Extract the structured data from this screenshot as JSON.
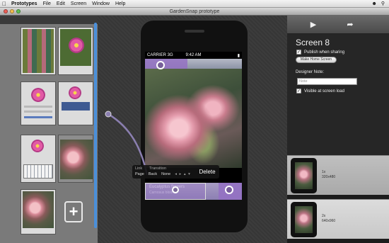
{
  "menubar": {
    "app_name": "Prototypes",
    "items": [
      "File",
      "Edit",
      "Screen",
      "Window",
      "Help"
    ],
    "right_icons": [
      "user-icon",
      "search-icon"
    ]
  },
  "window": {
    "title": "GardenSnap prototype"
  },
  "phone": {
    "carrier": "CARRIER 3G",
    "time": "9:42 AM",
    "bottom_title": "Eucalyptus flowers",
    "bottom_subtitle": "Carnosus blooms"
  },
  "link_popover": {
    "link_label": "Link",
    "transition_label": "Transition",
    "target_value": "Page",
    "back_label": "Back",
    "transition_value": "None",
    "delete_label": "Delete"
  },
  "inspector": {
    "screen_name": "Screen 8",
    "publish_label": "Publish when sharing",
    "publish_checked": true,
    "make_home_label": "Make Home Screen",
    "designer_note_label": "Designer Note:",
    "note_placeholder": "Note",
    "visible_label": "Visible at screen load",
    "visible_checked": true
  },
  "devices": [
    {
      "scale": "1x",
      "size": "320x480"
    },
    {
      "scale": "2x",
      "size": "640x960"
    }
  ]
}
